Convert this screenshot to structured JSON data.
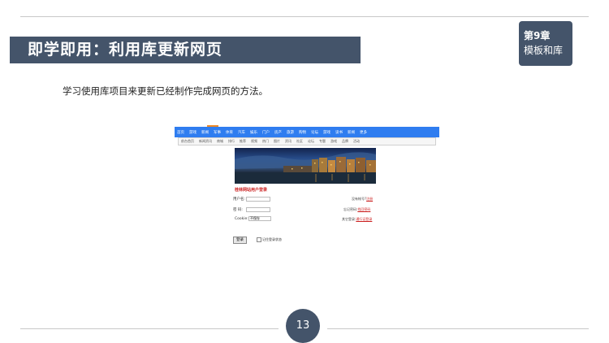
{
  "slide": {
    "title": "即学即用：利用库更新网页",
    "chapter_number": "第9章",
    "chapter_name": "模板和库",
    "description": "学习使用库项目来更新已经制作完成网页的方法。",
    "page_number": "13"
  },
  "screenshot": {
    "nav_primary": [
      "首页",
      "游戏",
      "新闻",
      "军事",
      "体育",
      "汽车",
      "娱乐",
      "门户",
      "房产",
      "旅游",
      "购物",
      "论坛",
      "游戏",
      "读书",
      "新闻",
      "更多"
    ],
    "nav_secondary": [
      "前台首页",
      "新闻资讯",
      "商城",
      "排行",
      "推荐",
      "视频",
      "热门",
      "图片",
      "资讯",
      "社区",
      "论坛",
      "专题",
      "游戏",
      "品牌",
      "活动"
    ],
    "form_title": "桂林网站用户登录",
    "fields": [
      "用户名:",
      "密  码:",
      "Cookie:"
    ],
    "cookie_option": "不保存",
    "links": [
      {
        "label": "没有帐号?",
        "link": "注册"
      },
      {
        "label": "忘记密码:",
        "link": "找回密码"
      },
      {
        "label": "其它登录:",
        "link": "通行证登录"
      }
    ],
    "login_button": "登录",
    "remember_label": "记住登录状态"
  }
}
